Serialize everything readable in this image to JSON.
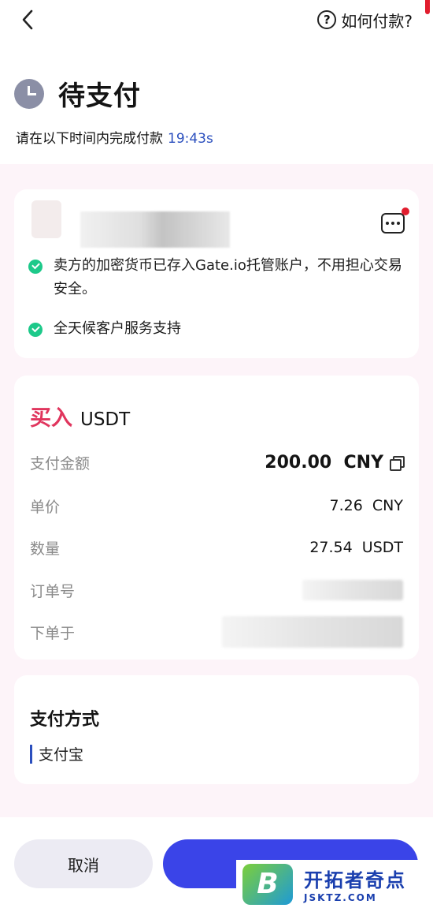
{
  "header": {
    "help_label": "如何付款?",
    "help_icon": "question-circle-icon"
  },
  "status": {
    "title": "待支付",
    "countdown_label": "请在以下时间内完成付款",
    "countdown_value": "19:43s"
  },
  "merchant": {
    "features": [
      "卖方的加密货币已存入Gate.io托管账户，不用担心交易安全。",
      "全天候客户服务支持"
    ]
  },
  "order": {
    "action": "买入",
    "coin": "USDT",
    "rows": [
      {
        "label": "支付金额",
        "value": "200.00  CNY"
      },
      {
        "label": "单价",
        "value": "7.26  CNY"
      },
      {
        "label": "数量",
        "value": "27.54  USDT"
      },
      {
        "label": "订单号",
        "value": ""
      },
      {
        "label": "下单于",
        "value": ""
      }
    ]
  },
  "payment": {
    "title": "支付方式",
    "method": "支付宝"
  },
  "actions": {
    "cancel_label": "取消",
    "pay_label": ""
  },
  "watermark": {
    "logo_letter": "B",
    "name": "开拓者奇点",
    "domain": "JSKTZ.COM"
  },
  "colors": {
    "accent_blue": "#3a44e8",
    "buy_red": "#e0355d",
    "check_green": "#1dc98a",
    "countdown_blue": "#2b4fbe"
  }
}
